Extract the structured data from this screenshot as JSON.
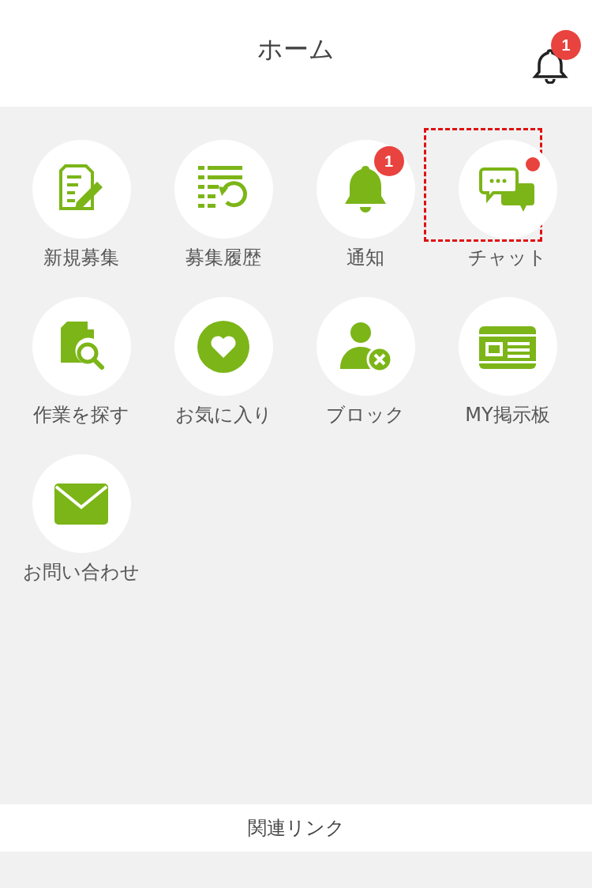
{
  "header": {
    "title": "ホーム",
    "notification_badge": "1"
  },
  "menu": [
    {
      "kind": "edit",
      "label": "新規募集",
      "highlighted": false,
      "dot": false
    },
    {
      "kind": "history",
      "label": "募集履歴",
      "highlighted": false,
      "dot": false
    },
    {
      "kind": "bell",
      "label": "通知",
      "badge": "1",
      "highlighted": false,
      "dot": false
    },
    {
      "kind": "chat",
      "label": "チャット",
      "highlighted": true,
      "dot": true
    },
    {
      "kind": "search-doc",
      "label": "作業を探す",
      "highlighted": false,
      "dot": false
    },
    {
      "kind": "heart",
      "label": "お気に入り",
      "highlighted": false,
      "dot": false
    },
    {
      "kind": "block-user",
      "label": "ブロック",
      "highlighted": false,
      "dot": false
    },
    {
      "kind": "board",
      "label": "MY掲示板",
      "highlighted": false,
      "dot": false
    },
    {
      "kind": "mail",
      "label": "お問い合わせ",
      "highlighted": false,
      "dot": false
    }
  ],
  "footer": {
    "title": "関連リンク"
  }
}
